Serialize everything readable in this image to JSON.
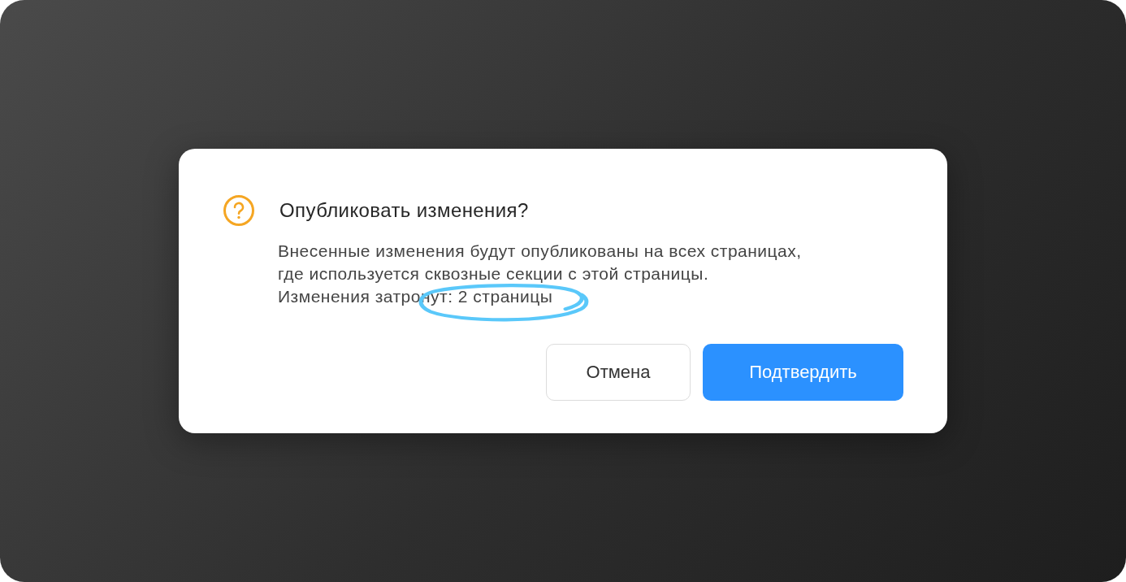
{
  "dialog": {
    "title": "Опубликовать изменения?",
    "message_lines": [
      "Внесенные изменения будут опубликованы на всех страницах,",
      "где используется сквозные секции с этой страницы.",
      "Изменения затронут: 2 страницы"
    ],
    "annotation": {
      "kind": "ellipse"
    },
    "buttons": [
      {
        "label": "Отмена",
        "kind": "secondary"
      },
      {
        "label": "Подтвердить",
        "kind": "primary"
      }
    ]
  }
}
